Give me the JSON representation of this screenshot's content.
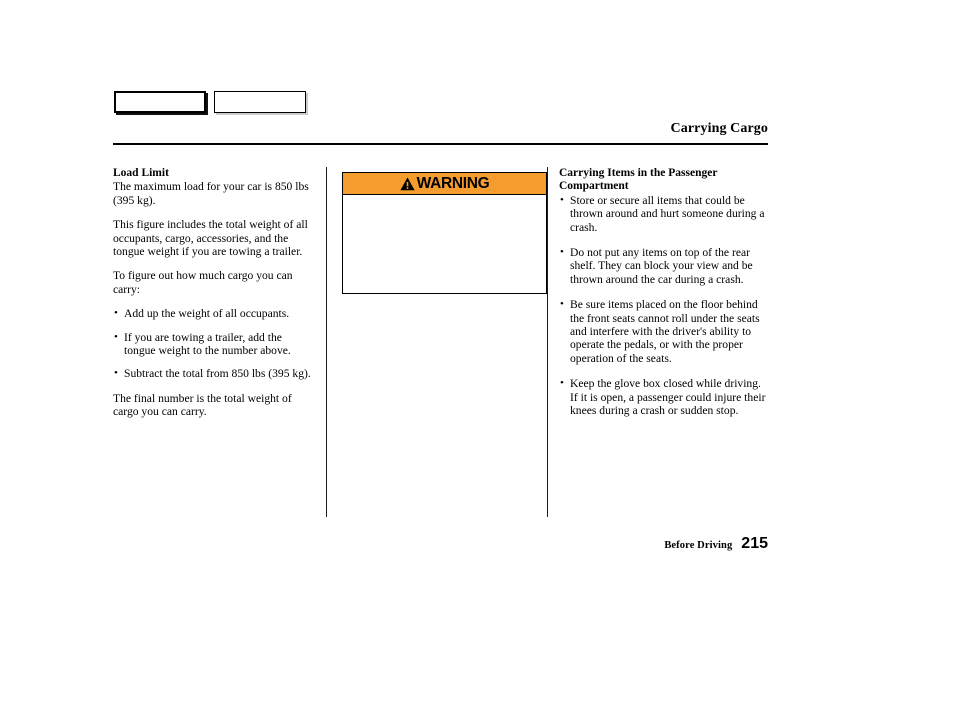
{
  "header": {
    "title": "Carrying Cargo",
    "tabs": [
      {
        "name": "tab-box-filled",
        "label": ""
      },
      {
        "name": "tab-box-outline",
        "label": ""
      }
    ]
  },
  "left_column": {
    "section_title": "Load Limit",
    "intro": "The maximum load for your car is 850 lbs (395 kg).",
    "paragraph_2": "This figure includes the total weight of all occupants, cargo, accessories, and the tongue weight if you are towing a trailer.",
    "paragraph_3": "To figure out how much cargo you can carry:",
    "bullets": [
      "Add up the weight of all occupants.",
      "If you are towing a trailer, add the tongue weight to the number above.",
      "Subtract the total from 850 lbs (395 kg)."
    ],
    "closing": "The final number is the total weight of cargo you can carry."
  },
  "warning": {
    "label": "WARNING",
    "icon": "warning-triangle-icon",
    "header_color": "#f59c2e",
    "body_text": ""
  },
  "right_column": {
    "section_title": "Carrying Items in the Passenger Compartment",
    "bullets": [
      "Store or secure all items that could be thrown around and hurt someone during a crash.",
      "Do not put any items on top of the rear shelf. They can block your view and be thrown around the car during a crash.",
      "Be sure items placed on the floor behind the front seats cannot roll under the seats and interfere with the driver's ability to operate the pedals, or with the proper operation of the seats.",
      "Keep the glove box closed while driving. If it is open, a passenger could injure their knees during a crash or sudden stop."
    ]
  },
  "footer": {
    "section": "Before Driving",
    "page_number": "215"
  }
}
